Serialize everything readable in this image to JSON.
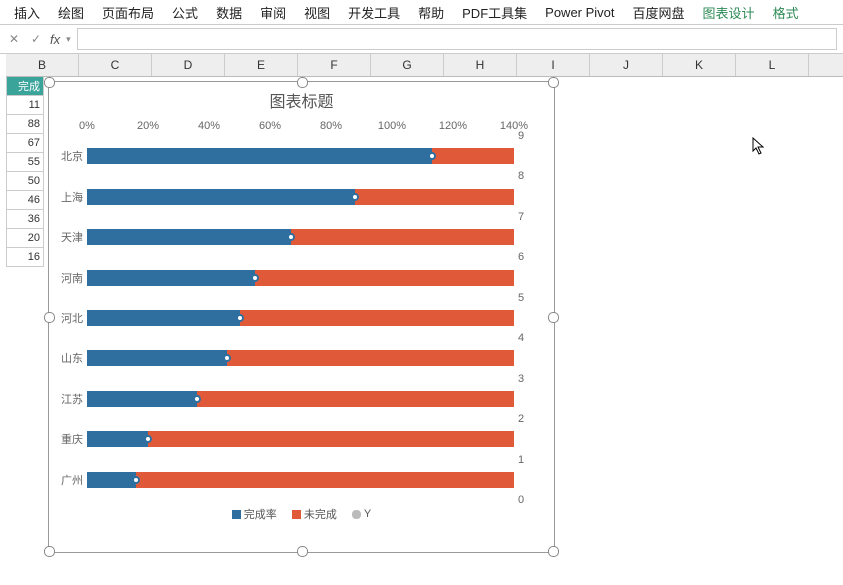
{
  "ribbon": {
    "tabs": [
      "插入",
      "绘图",
      "页面布局",
      "公式",
      "数据",
      "审阅",
      "视图",
      "开发工具",
      "帮助",
      "PDF工具集",
      "Power Pivot",
      "百度网盘"
    ],
    "context": [
      "图表设计",
      "格式"
    ]
  },
  "formula_bar": {
    "cancel": "✕",
    "confirm": "✓",
    "fx": "fx"
  },
  "columns": [
    "B",
    "C",
    "D",
    "E",
    "F",
    "G",
    "H",
    "I",
    "J",
    "K",
    "L"
  ],
  "rows": {
    "header": "完成",
    "values": [
      "11",
      "88",
      "67",
      "55",
      "50",
      "46",
      "36",
      "20",
      "16"
    ]
  },
  "chart_data": {
    "type": "bar",
    "title": "图表标题",
    "categories": [
      "北京",
      "上海",
      "天津",
      "河南",
      "河北",
      "山东",
      "江苏",
      "重庆",
      "广州"
    ],
    "series": [
      {
        "name": "完成率",
        "values": [
          113,
          88,
          67,
          55,
          50,
          46,
          36,
          20,
          16
        ],
        "color": "#2f6f9f"
      },
      {
        "name": "未完成",
        "values": [
          27,
          52,
          73,
          85,
          90,
          94,
          104,
          120,
          124
        ],
        "color": "#e05a3a"
      },
      {
        "name": "Y",
        "values": [
          113,
          88,
          67,
          55,
          50,
          46,
          36,
          20,
          16
        ],
        "color": "#cccccc"
      }
    ],
    "xlabel": "",
    "ylabel": "",
    "xlim": [
      0,
      140
    ],
    "xticks": [
      0,
      20,
      40,
      60,
      80,
      100,
      120,
      140
    ],
    "y2lim": [
      0,
      9
    ],
    "y2ticks": [
      0,
      1,
      2,
      3,
      4,
      5,
      6,
      7,
      8,
      9
    ],
    "legend": [
      "完成率",
      "未完成",
      "Y"
    ]
  }
}
